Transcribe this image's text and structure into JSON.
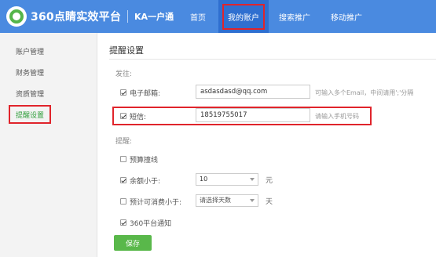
{
  "header": {
    "brand": "360点睛实效平台",
    "product": "KA一户通",
    "nav": [
      {
        "label": "首页"
      },
      {
        "label": "我的账户"
      },
      {
        "label": "搜索推广"
      },
      {
        "label": "移动推广"
      }
    ]
  },
  "sidebar": {
    "items": [
      {
        "label": "账户管理"
      },
      {
        "label": "财务管理"
      },
      {
        "label": "资质管理"
      },
      {
        "label": "提醒设置"
      }
    ]
  },
  "main": {
    "title": "提醒设置",
    "send_group": "发往:",
    "email": {
      "label": "电子邮箱:",
      "value": "asdasdasd@qq.com",
      "hint": "可输入多个Email，中间请用';'分隔",
      "checked": true
    },
    "sms": {
      "label": "短信:",
      "value": "18519755017",
      "hint": "请输入手机号码",
      "checked": true
    },
    "remind_group": "提醒:",
    "options": {
      "budget": {
        "label": "预算撞线",
        "checked": false
      },
      "balance": {
        "label": "余额小于:",
        "value": "10",
        "unit": "元",
        "checked": true
      },
      "days": {
        "label": "预计可消费小于:",
        "value": "请选择天数",
        "unit": "天",
        "checked": false
      },
      "notice": {
        "label": "360平台通知",
        "checked": true
      }
    },
    "save_label": "保存"
  },
  "colors": {
    "header_bg": "#4a8ae0",
    "nav_active_bg": "#2f6fd0",
    "highlight_red": "#e0242b",
    "accent_green": "#59b84a"
  }
}
